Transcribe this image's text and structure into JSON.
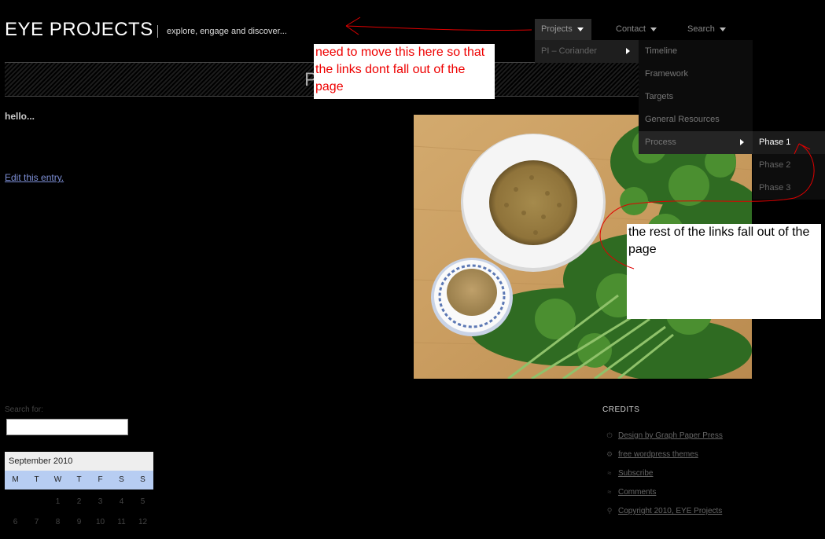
{
  "site": {
    "title": "EYE PROJECTS",
    "tagline": "explore, engage and discover..."
  },
  "banner": {
    "letter": "P"
  },
  "nav": {
    "items": [
      {
        "label": "Projects"
      },
      {
        "label": "Contact"
      },
      {
        "label": "Search"
      }
    ],
    "projects_menu": [
      {
        "label": "PI – Coriander"
      }
    ],
    "coriander_menu": [
      {
        "label": "Timeline"
      },
      {
        "label": "Framework"
      },
      {
        "label": "Targets"
      },
      {
        "label": "General Resources"
      },
      {
        "label": "Process"
      }
    ],
    "process_menu": [
      {
        "label": "Phase 1"
      },
      {
        "label": "Phase 2"
      },
      {
        "label": "Phase 3"
      }
    ]
  },
  "annotations": {
    "note_top": "need to move this here so that the links dont fall out of the page",
    "note_right": "the rest of the links fall out of the page",
    "color": "#e00000"
  },
  "post": {
    "text": "hello...",
    "edit_link": "Edit this entry."
  },
  "sidebar": {
    "search_label": "Search for:",
    "search_value": "",
    "calendar": {
      "month": "September 2010",
      "days": [
        "M",
        "T",
        "W",
        "T",
        "F",
        "S",
        "S"
      ],
      "rows": [
        [
          "",
          "",
          "1",
          "2",
          "3",
          "4",
          "5"
        ],
        [
          "6",
          "7",
          "8",
          "9",
          "10",
          "11",
          "12"
        ]
      ]
    }
  },
  "credits": {
    "title": "CREDITS",
    "items": [
      {
        "icon": "power-icon",
        "label": "Design by Graph Paper Press"
      },
      {
        "icon": "gear-icon",
        "label": "free wordpress themes"
      },
      {
        "icon": "rss-icon",
        "label": "Subscribe"
      },
      {
        "icon": "rss-icon",
        "label": "Comments"
      },
      {
        "icon": "key-icon",
        "label": "Copyright 2010, EYE Projects"
      }
    ]
  }
}
